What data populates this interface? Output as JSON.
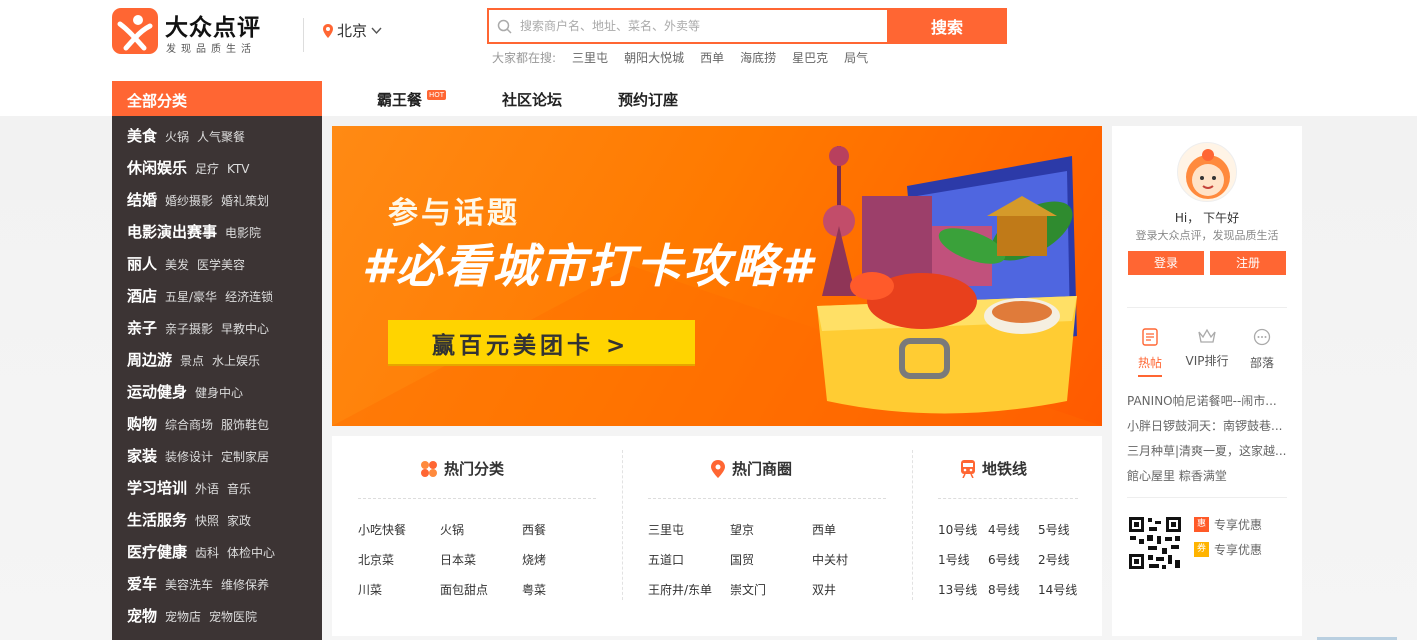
{
  "brand": {
    "name": "大众点评",
    "slogan": "发现品质生活",
    "color": "#ff6633"
  },
  "header": {
    "city": "北京",
    "search": {
      "placeholder": "搜索商户名、地址、菜名、外卖等",
      "button_label": "搜索"
    },
    "hot_label": "大家都在搜:",
    "hot_words": [
      "三里屯",
      "朝阳大悦城",
      "西单",
      "海底捞",
      "星巴克",
      "局气"
    ]
  },
  "nav": {
    "category_header": "全部分类",
    "items": [
      {
        "label": "霸王餐",
        "badge": "HOT"
      },
      {
        "label": "社区论坛"
      },
      {
        "label": "预约订座"
      }
    ]
  },
  "categories": [
    {
      "name": "美食",
      "subs": [
        "火锅",
        "人气聚餐"
      ]
    },
    {
      "name": "休闲娱乐",
      "subs": [
        "足疗",
        "KTV"
      ]
    },
    {
      "name": "结婚",
      "subs": [
        "婚纱摄影",
        "婚礼策划"
      ]
    },
    {
      "name": "电影演出赛事",
      "subs": [
        "电影院"
      ]
    },
    {
      "name": "丽人",
      "subs": [
        "美发",
        "医学美容"
      ]
    },
    {
      "name": "酒店",
      "subs": [
        "五星/豪华",
        "经济连锁"
      ]
    },
    {
      "name": "亲子",
      "subs": [
        "亲子摄影",
        "早教中心"
      ]
    },
    {
      "name": "周边游",
      "subs": [
        "景点",
        "水上娱乐"
      ]
    },
    {
      "name": "运动健身",
      "subs": [
        "健身中心"
      ]
    },
    {
      "name": "购物",
      "subs": [
        "综合商场",
        "服饰鞋包"
      ]
    },
    {
      "name": "家装",
      "subs": [
        "装修设计",
        "定制家居"
      ]
    },
    {
      "name": "学习培训",
      "subs": [
        "外语",
        "音乐"
      ]
    },
    {
      "name": "生活服务",
      "subs": [
        "快照",
        "家政"
      ]
    },
    {
      "name": "医疗健康",
      "subs": [
        "齿科",
        "体检中心"
      ]
    },
    {
      "name": "爱车",
      "subs": [
        "美容洗车",
        "维修保养"
      ]
    },
    {
      "name": "宠物",
      "subs": [
        "宠物店",
        "宠物医院"
      ]
    }
  ],
  "banner": {
    "topic": "参与话题",
    "title": "#必看城市打卡攻略#",
    "cta": "赢百元美团卡 >"
  },
  "hot_sections": {
    "categories": {
      "title": "热门分类",
      "items": [
        "小吃快餐",
        "火锅",
        "西餐",
        "北京菜",
        "日本菜",
        "烧烤",
        "川菜",
        "面包甜点",
        "粤菜"
      ]
    },
    "districts": {
      "title": "热门商圈",
      "items": [
        "三里屯",
        "望京",
        "西单",
        "五道口",
        "国贸",
        "中关村",
        "王府井/东单",
        "崇文门",
        "双井"
      ]
    },
    "subway": {
      "title": "地铁线",
      "items": [
        "10号线",
        "4号线",
        "5号线",
        "1号线",
        "6号线",
        "2号线",
        "13号线",
        "8号线",
        "14号线"
      ]
    }
  },
  "user_panel": {
    "greeting": "Hi，  下午好",
    "login_tip": "登录大众点评，发现品质生活",
    "login_label": "登录",
    "register_label": "注册",
    "tabs": [
      "热帖",
      "VIP排行",
      "部落"
    ],
    "active_tab": "热帖",
    "posts": [
      "PANINO帕尼诺餐吧--闹市...",
      "小胖日锣鼓洞天：南锣鼓巷...",
      "三月种草|清爽一夏，这家越...",
      "館心屋里 粽香满堂"
    ],
    "promos": [
      {
        "tag": "惠",
        "text": "专享优惠",
        "color": "#ff5a28"
      },
      {
        "tag": "券",
        "text": "专享优惠",
        "color": "#ffb400"
      }
    ]
  }
}
